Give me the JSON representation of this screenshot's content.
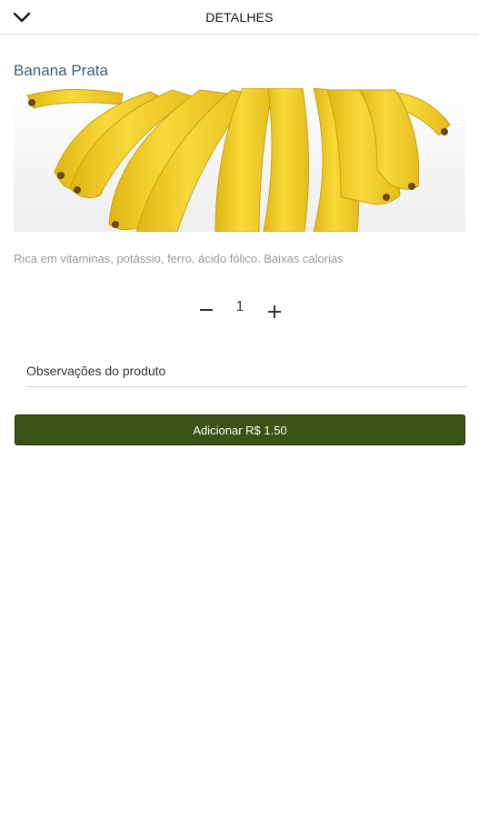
{
  "header": {
    "title": "DETALHES"
  },
  "product": {
    "name": "Banana Prata",
    "description": "Rica em vitaminas, potássio, ferro, ácido fólico. Baixas calorias",
    "image_subject": "bunch of yellow bananas"
  },
  "quantity": {
    "value": "1"
  },
  "notes": {
    "placeholder": "Observações do produto",
    "value": ""
  },
  "add_button": {
    "label": "Adicionar R$ 1.50"
  },
  "colors": {
    "accent_button": "#3b5315",
    "product_name": "#3b5f7a",
    "banana_yellow": "#f2cf2a"
  },
  "icons": {
    "back": "chevron-down-icon",
    "minus": "minus-icon",
    "plus": "plus-icon"
  }
}
